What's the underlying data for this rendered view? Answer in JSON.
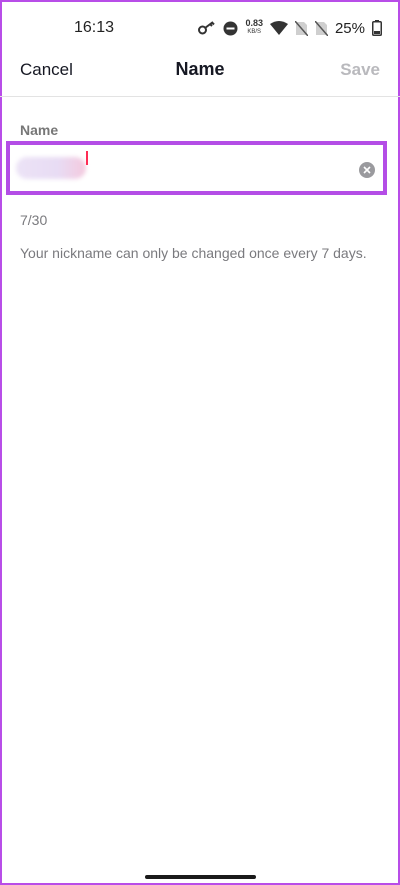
{
  "status_bar": {
    "time": "16:13",
    "net_speed_value": "0.83",
    "net_speed_unit": "KB/S",
    "battery_percent": "25%",
    "icons": [
      "key-icon",
      "do-not-disturb-icon",
      "wifi-icon",
      "no-sim-icon",
      "no-sim-icon",
      "battery-icon"
    ]
  },
  "nav": {
    "cancel_label": "Cancel",
    "title": "Name",
    "save_label": "Save"
  },
  "form": {
    "field_label": "Name",
    "char_count": "7/30",
    "hint": "Your nickname can only be changed once every 7 days."
  },
  "colors": {
    "highlight": "#b44de6",
    "caret": "#fe2c55",
    "disabled_text": "#b9b9bd"
  }
}
